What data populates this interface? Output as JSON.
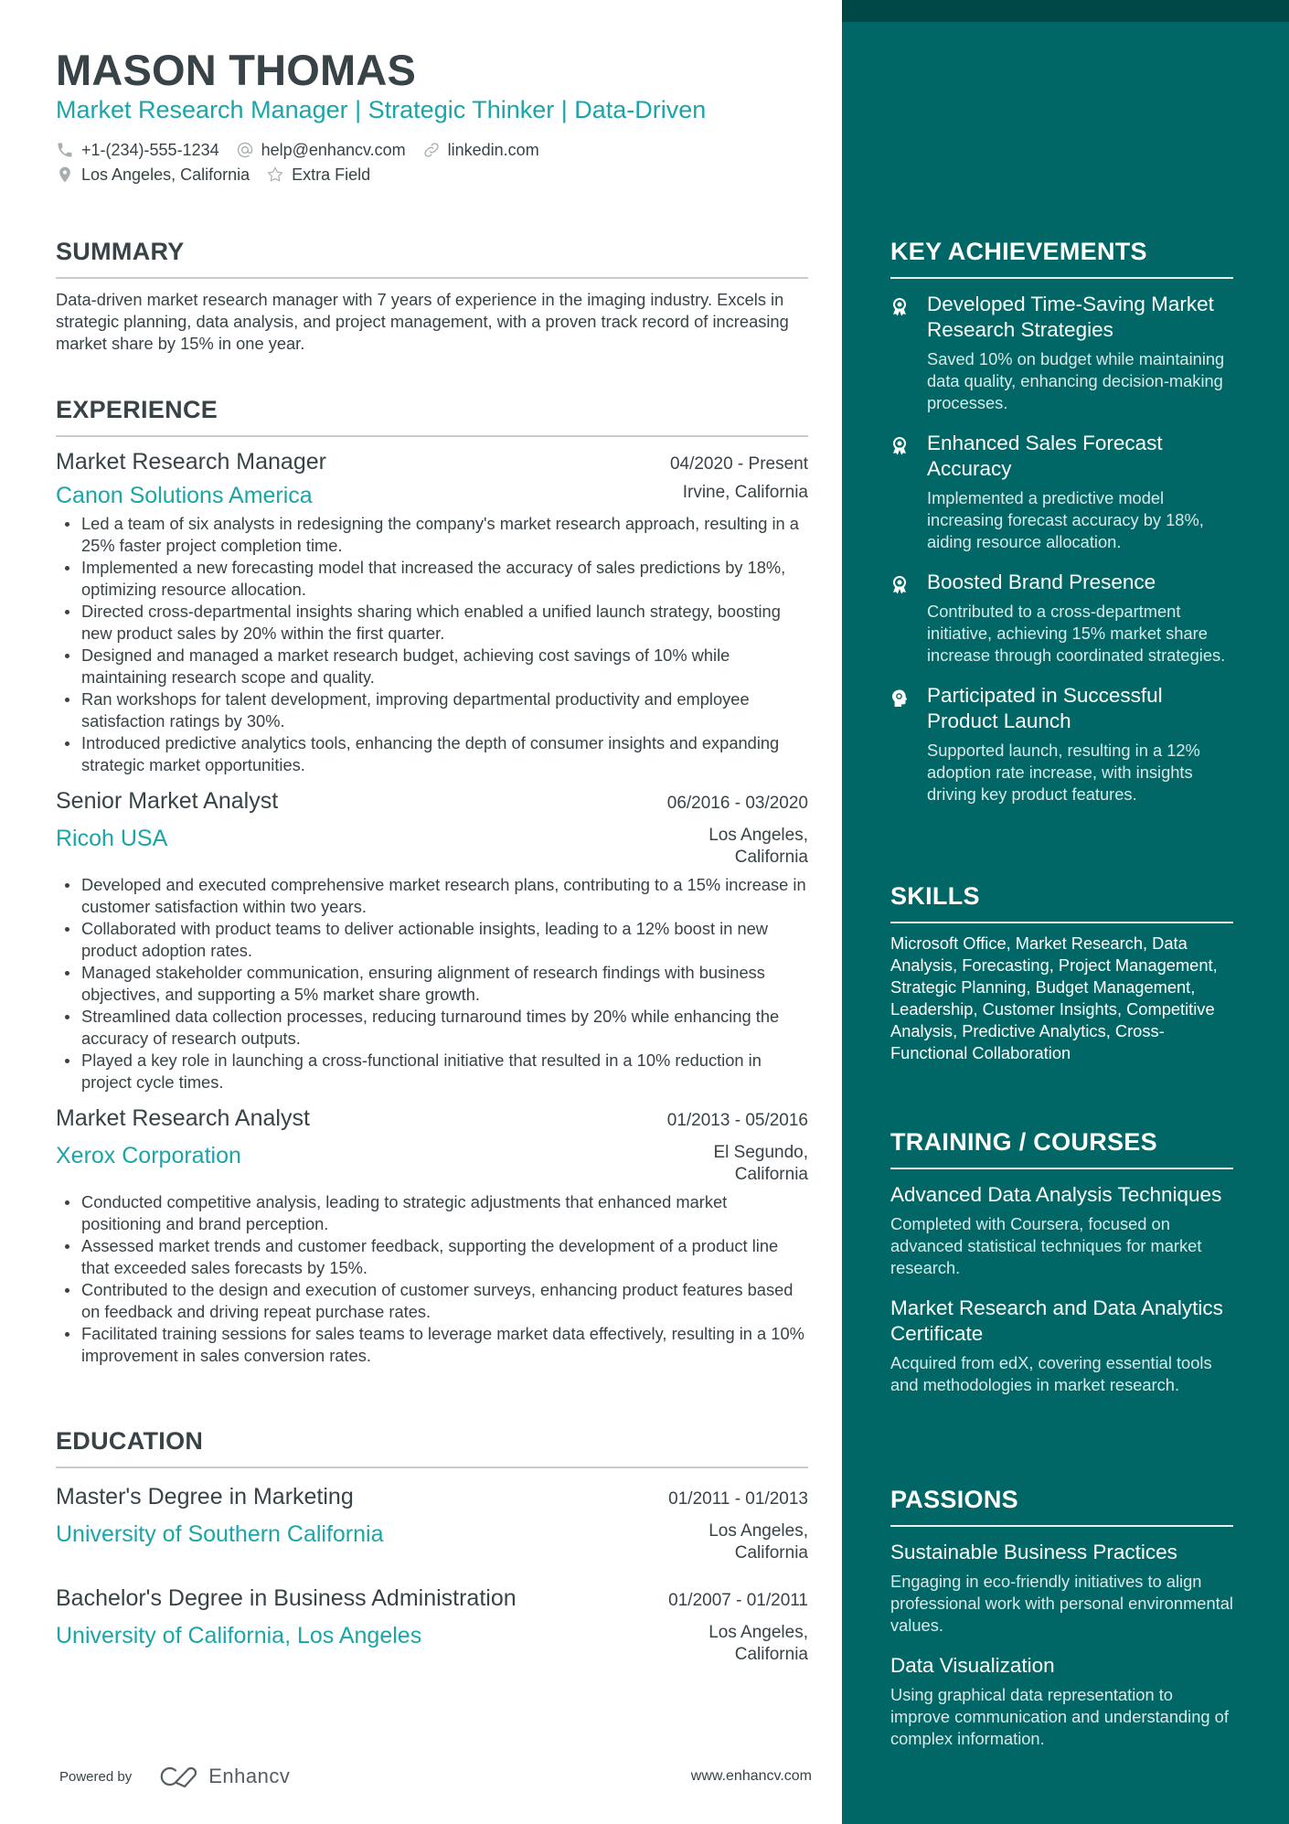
{
  "header": {
    "name": "MASON THOMAS",
    "tagline": "Market Research Manager | Strategic Thinker | Data-Driven",
    "contacts": {
      "phone": "+1-(234)-555-1234",
      "email": "help@enhancv.com",
      "link": "linkedin.com",
      "location": "Los Angeles, California",
      "extra": "Extra Field"
    }
  },
  "summary": {
    "title": "SUMMARY",
    "text": "Data-driven market research manager with 7 years of experience in the imaging industry. Excels in strategic planning, data analysis, and project management, with a proven track record of increasing market share by 15% in one year."
  },
  "experience": {
    "title": "EXPERIENCE",
    "jobs": [
      {
        "title": "Market Research Manager",
        "date": "04/2020 - Present",
        "company": "Canon Solutions America",
        "location": "Irvine, California",
        "bullets": [
          "Led a team of six analysts in redesigning the company's market research approach, resulting in a 25% faster project completion time.",
          "Implemented a new forecasting model that increased the accuracy of sales predictions by 18%, optimizing resource allocation.",
          "Directed cross-departmental insights sharing which enabled a unified launch strategy, boosting new product sales by 20% within the first quarter.",
          "Designed and managed a market research budget, achieving cost savings of 10% while maintaining research scope and quality.",
          "Ran workshops for talent development, improving departmental productivity and employee satisfaction ratings by 30%.",
          "Introduced predictive analytics tools, enhancing the depth of consumer insights and expanding strategic market opportunities."
        ]
      },
      {
        "title": "Senior Market Analyst",
        "date": "06/2016 - 03/2020",
        "company": "Ricoh USA",
        "location": "Los Angeles, California",
        "bullets": [
          "Developed and executed comprehensive market research plans, contributing to a 15% increase in customer satisfaction within two years.",
          "Collaborated with product teams to deliver actionable insights, leading to a 12% boost in new product adoption rates.",
          "Managed stakeholder communication, ensuring alignment of research findings with business objectives, and supporting a 5% market share growth.",
          "Streamlined data collection processes, reducing turnaround times by 20% while enhancing the accuracy of research outputs.",
          "Played a key role in launching a cross-functional initiative that resulted in a 10% reduction in project cycle times."
        ]
      },
      {
        "title": "Market Research Analyst",
        "date": "01/2013 - 05/2016",
        "company": "Xerox Corporation",
        "location": "El Segundo, California",
        "bullets": [
          "Conducted competitive analysis, leading to strategic adjustments that enhanced market positioning and brand perception.",
          "Assessed market trends and customer feedback, supporting the development of a product line that exceeded sales forecasts by 15%.",
          "Contributed to the design and execution of customer surveys, enhancing product features based on feedback and driving repeat purchase rates.",
          "Facilitated training sessions for sales teams to leverage market data effectively, resulting in a 10% improvement in sales conversion rates."
        ]
      }
    ]
  },
  "education": {
    "title": "EDUCATION",
    "items": [
      {
        "degree": "Master's Degree in Marketing",
        "date": "01/2011 - 01/2013",
        "school": "University of Southern California",
        "location": "Los Angeles, California"
      },
      {
        "degree": "Bachelor's Degree in Business Administration",
        "date": "01/2007 - 01/2011",
        "school": "University of California, Los Angeles",
        "location": "Los Angeles, California"
      }
    ]
  },
  "footer": {
    "powered_by": "Powered by",
    "brand": "Enhancv",
    "website": "www.enhancv.com"
  },
  "achievements": {
    "title": "KEY ACHIEVEMENTS",
    "items": [
      {
        "icon": "award-icon",
        "title": "Developed Time-Saving Market Research Strategies",
        "desc": "Saved 10% on budget while maintaining data quality, enhancing decision-making processes."
      },
      {
        "icon": "award-icon",
        "title": "Enhanced Sales Forecast Accuracy",
        "desc": "Implemented a predictive model increasing forecast accuracy by 18%, aiding resource allocation."
      },
      {
        "icon": "award-icon",
        "title": "Boosted Brand Presence",
        "desc": "Contributed to a cross-department initiative, achieving 15% market share increase through coordinated strategies."
      },
      {
        "icon": "head-idea-icon",
        "title": "Participated in Successful Product Launch",
        "desc": "Supported launch, resulting in a 12% adoption rate increase, with insights driving key product features."
      }
    ]
  },
  "skills": {
    "title": "SKILLS",
    "text": "Microsoft Office, Market Research, Data Analysis, Forecasting, Project Management, Strategic Planning, Budget Management, Leadership, Customer Insights, Competitive Analysis, Predictive Analytics, Cross-Functional Collaboration"
  },
  "training": {
    "title": "TRAINING / COURSES",
    "items": [
      {
        "title": "Advanced Data Analysis Techniques",
        "desc": "Completed with Coursera, focused on advanced statistical techniques for market research."
      },
      {
        "title": "Market Research and Data Analytics Certificate",
        "desc": "Acquired from edX, covering essential tools and methodologies in market research."
      }
    ]
  },
  "passions": {
    "title": "PASSIONS",
    "items": [
      {
        "title": "Sustainable Business Practices",
        "desc": "Engaging in eco-friendly initiatives to align professional work with personal environmental values."
      },
      {
        "title": "Data Visualization",
        "desc": "Using graphical data representation to improve communication and understanding of complex information."
      }
    ]
  },
  "colors": {
    "accent": "#1aa6a9",
    "text": "#384347",
    "sidebar": "#006766",
    "sidebar_band": "#004848"
  }
}
